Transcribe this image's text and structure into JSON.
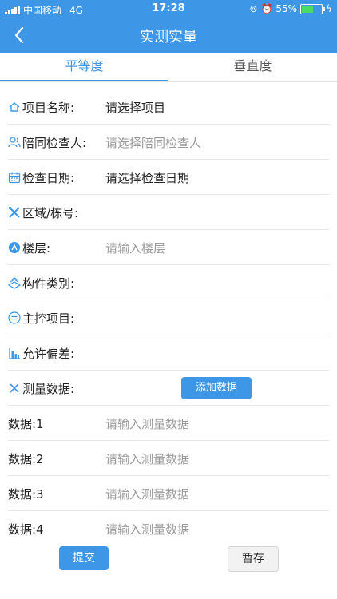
{
  "status": {
    "carrier": "中国移动",
    "network": "4G",
    "time": "17:28",
    "battery": "55%"
  },
  "nav": {
    "title": "实测实量",
    "back_icon": "back-chevron-icon"
  },
  "tabs": [
    {
      "label": "平等度"
    },
    {
      "label": "垂直度"
    }
  ],
  "form": {
    "project": {
      "label": "项目名称:",
      "value": "请选择项目"
    },
    "companion": {
      "label": "陪同检查人:",
      "placeholder": "请选择陪同检查人"
    },
    "check_date": {
      "label": "检查日期:",
      "value": "请选择检查日期"
    },
    "area": {
      "label": "区域/栋号:"
    },
    "floor": {
      "label": "楼层:",
      "placeholder": "请输入楼层"
    },
    "component": {
      "label": "构件类别:"
    },
    "main_item": {
      "label": "主控项目:"
    },
    "tolerance": {
      "label": "允许偏差:"
    },
    "measure": {
      "label": "测量数据:",
      "add_button": "添加数据"
    },
    "data": [
      {
        "label": "数据:1",
        "placeholder": "请输入测量数据"
      },
      {
        "label": "数据:2",
        "placeholder": "请输入测量数据"
      },
      {
        "label": "数据:3",
        "placeholder": "请输入测量数据"
      },
      {
        "label": "数据:4",
        "placeholder": "请输入测量数据"
      }
    ]
  },
  "actions": {
    "submit": "提交",
    "save": "暂存"
  },
  "colors": {
    "accent": "#3d97e6",
    "placeholder": "#9a9a9a",
    "divider": "#e6e6e6"
  }
}
